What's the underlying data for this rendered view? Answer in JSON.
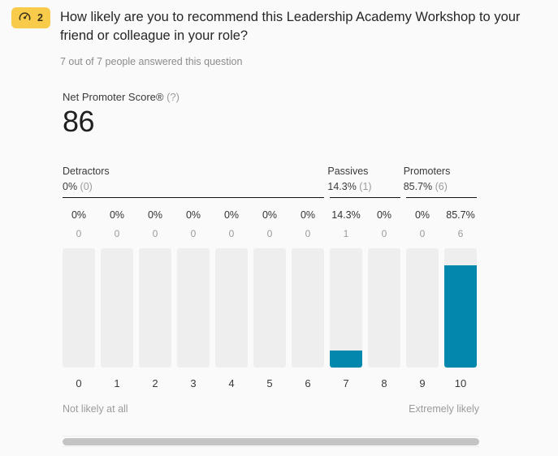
{
  "question": {
    "badge_icon": "gauge-icon",
    "badge_number": "2",
    "badge_color": "#f9cb4b",
    "title": "How likely are you to recommend this Leadership Academy Workshop to your friend or colleague in your role?",
    "answered_text": "7 out of 7 people answered this question"
  },
  "nps": {
    "label": "Net Promoter Score®",
    "help": "(?)",
    "score": "86"
  },
  "categories": [
    {
      "name": "Detractors",
      "percent": "0%",
      "count": "(0)"
    },
    {
      "name": "Passives",
      "percent": "14.3%",
      "count": "(1)"
    },
    {
      "name": "Promoters",
      "percent": "85.7%",
      "count": "(6)"
    }
  ],
  "endpoints": {
    "left": "Not likely at all",
    "right": "Extremely likely"
  },
  "colors": {
    "bar_fill": "#0487ad",
    "bar_track": "#eeeeee",
    "badge": "#f9cb4b"
  },
  "chart_data": {
    "type": "bar",
    "title": "How likely are you to recommend this Leadership Academy Workshop to your friend or colleague in your role?",
    "xlabel": "",
    "ylabel": "",
    "ylim": [
      0,
      100
    ],
    "categories": [
      "0",
      "1",
      "2",
      "3",
      "4",
      "5",
      "6",
      "7",
      "8",
      "9",
      "10"
    ],
    "percent_labels": [
      "0%",
      "0%",
      "0%",
      "0%",
      "0%",
      "0%",
      "0%",
      "14.3%",
      "0%",
      "0%",
      "85.7%"
    ],
    "values": [
      0,
      0,
      0,
      0,
      0,
      0,
      0,
      14.3,
      0,
      0,
      85.7
    ],
    "counts": [
      "0",
      "0",
      "0",
      "0",
      "0",
      "0",
      "0",
      "1",
      "0",
      "0",
      "6"
    ],
    "total_responses": 7,
    "grid": false,
    "legend": "none",
    "nps_groups": [
      {
        "name": "Detractors",
        "span": [
          "0",
          "6"
        ],
        "percent": 0,
        "count": 0
      },
      {
        "name": "Passives",
        "span": [
          "7",
          "8"
        ],
        "percent": 14.3,
        "count": 1
      },
      {
        "name": "Promoters",
        "span": [
          "9",
          "10"
        ],
        "percent": 85.7,
        "count": 6
      }
    ],
    "net_promoter_score": 86
  }
}
